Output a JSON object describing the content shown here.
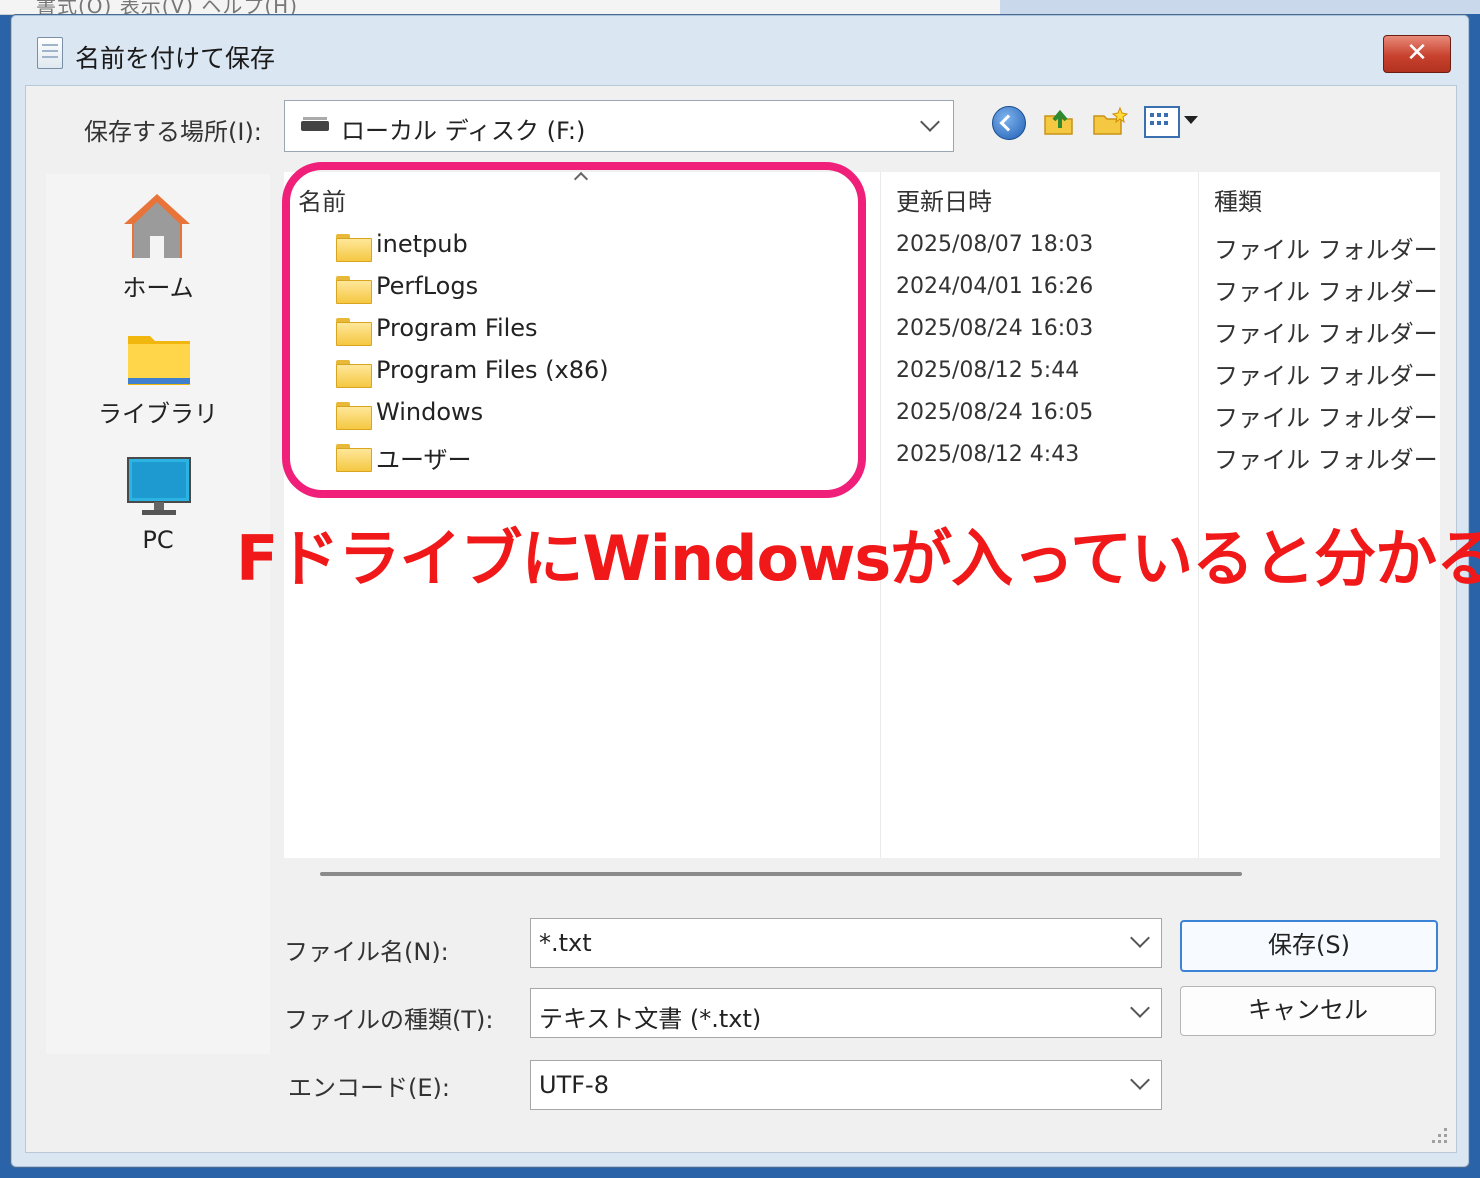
{
  "dialog": {
    "title": "名前を付けて保存",
    "close_label": "✕"
  },
  "location": {
    "label": "保存する場所(I):",
    "value": "ローカル ディスク (F:)"
  },
  "toolbar": {
    "icons": [
      "back-icon",
      "up-folder-icon",
      "new-folder-icon",
      "view-menu-icon"
    ]
  },
  "places": [
    {
      "label": "ホーム",
      "icon": "home-icon"
    },
    {
      "label": "ライブラリ",
      "icon": "library-icon"
    },
    {
      "label": "PC",
      "icon": "pc-icon"
    }
  ],
  "columns": {
    "name": "名前",
    "date": "更新日時",
    "type": "種類"
  },
  "files": [
    {
      "name": "inetpub",
      "date": "2025/08/07 18:03",
      "type": "ファイル フォルダー"
    },
    {
      "name": "PerfLogs",
      "date": "2024/04/01 16:26",
      "type": "ファイル フォルダー"
    },
    {
      "name": "Program Files",
      "date": "2025/08/24 16:03",
      "type": "ファイル フォルダー"
    },
    {
      "name": "Program Files (x86)",
      "date": "2025/08/12 5:44",
      "type": "ファイル フォルダー"
    },
    {
      "name": "Windows",
      "date": "2025/08/24 16:05",
      "type": "ファイル フォルダー"
    },
    {
      "name": "ユーザー",
      "date": "2025/08/12 4:43",
      "type": "ファイル フォルダー"
    }
  ],
  "annotation": {
    "text": "FドライブにWindowsが入っていると分かる",
    "color": "#f01818",
    "box_color": "#f0207a"
  },
  "form": {
    "filename_label": "ファイル名(N):",
    "filename_value": "*.txt",
    "filetype_label": "ファイルの種類(T):",
    "filetype_value": "テキスト文書 (*.txt)",
    "encoding_label": "エンコード(E):",
    "encoding_value": "UTF-8",
    "save_button": "保存(S)",
    "cancel_button": "キャンセル"
  },
  "background": {
    "menu_text": "書式(O)   表示(V)   ヘルプ(H)"
  }
}
